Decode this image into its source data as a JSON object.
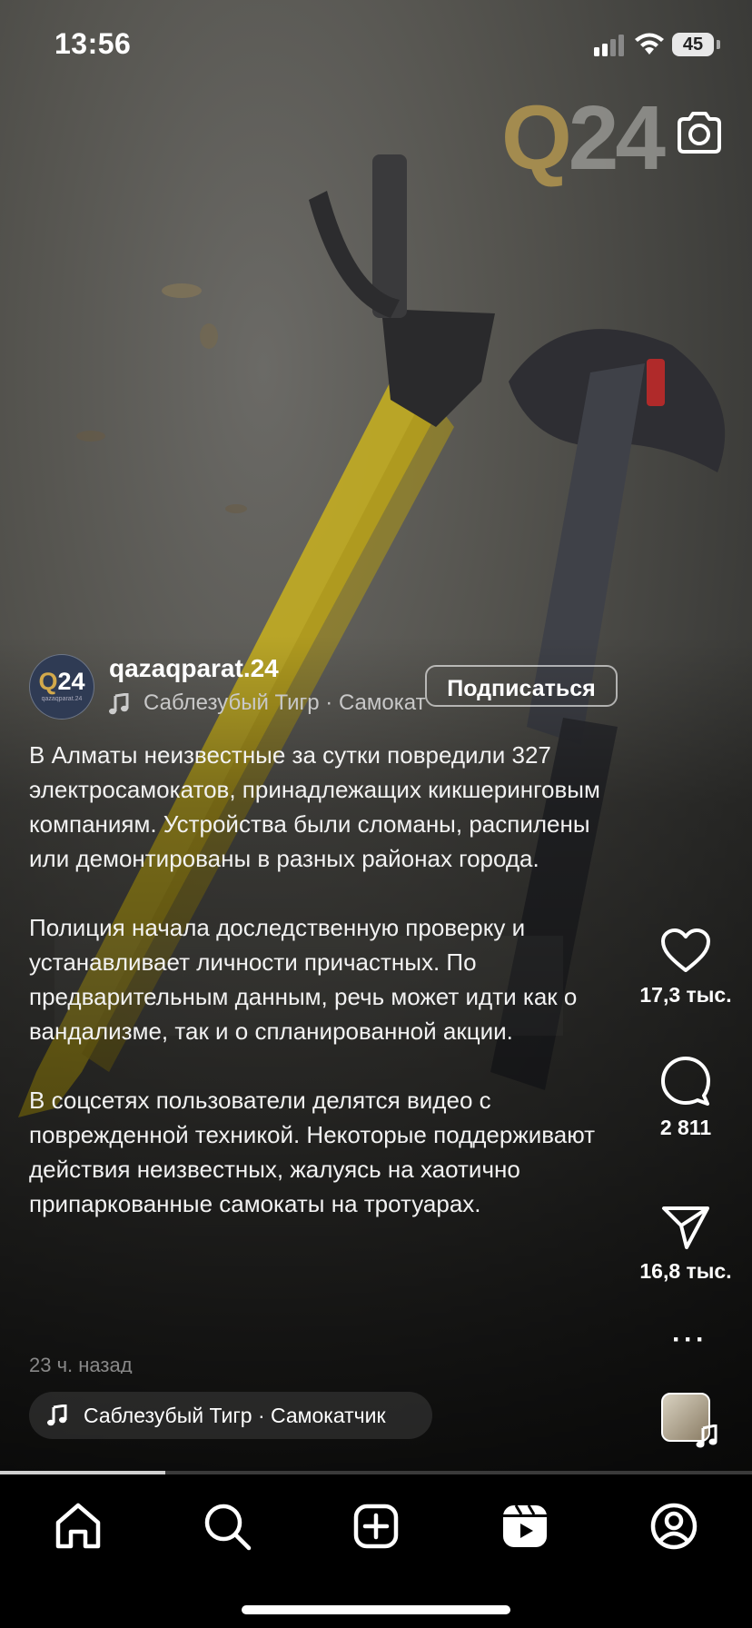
{
  "status_bar": {
    "time": "13:56",
    "battery": "45"
  },
  "watermark": {
    "q": "Q",
    "num": "24"
  },
  "author": {
    "avatar_main": "Q24",
    "avatar_q": "Q",
    "avatar_num": "24",
    "avatar_sub": "qazaqparat.24",
    "username": "qazaqparat.24",
    "music": "Саблезубый Тигр · Самокатчик",
    "follow_label": "Подписаться"
  },
  "caption": {
    "p1": "В Алматы неизвестные за сутки повредили 327 электросамокатов, принадлежащих кикшеринговым компаниям. Устройства были сломаны, распилены или демонтированы в разных районах города.",
    "p2": "Полиция начала доследственную проверку и устанавливает личности причастных. По предварительным данным, речь может идти как о вандализме, так и о спланированной акции.",
    "p3": "В соцсетях пользователи делятся видео с поврежденной техникой. Некоторые поддерживают действия неизвестных, жалуясь на хаотично припаркованные самокаты на тротуарах.",
    "time_ago": "23 ч. назад"
  },
  "actions": {
    "likes": "17,3 тыс.",
    "comments": "2 811",
    "shares": "16,8 тыс.",
    "more": "···"
  },
  "music_pill": "Саблезубый Тигр · Самокатчик",
  "progress": 0.22,
  "nav": {
    "items": [
      "home-icon",
      "search-icon",
      "create-icon",
      "reels-icon",
      "profile-icon"
    ]
  },
  "colors": {
    "accent_gold": "#b89a50",
    "background": "#000000"
  }
}
